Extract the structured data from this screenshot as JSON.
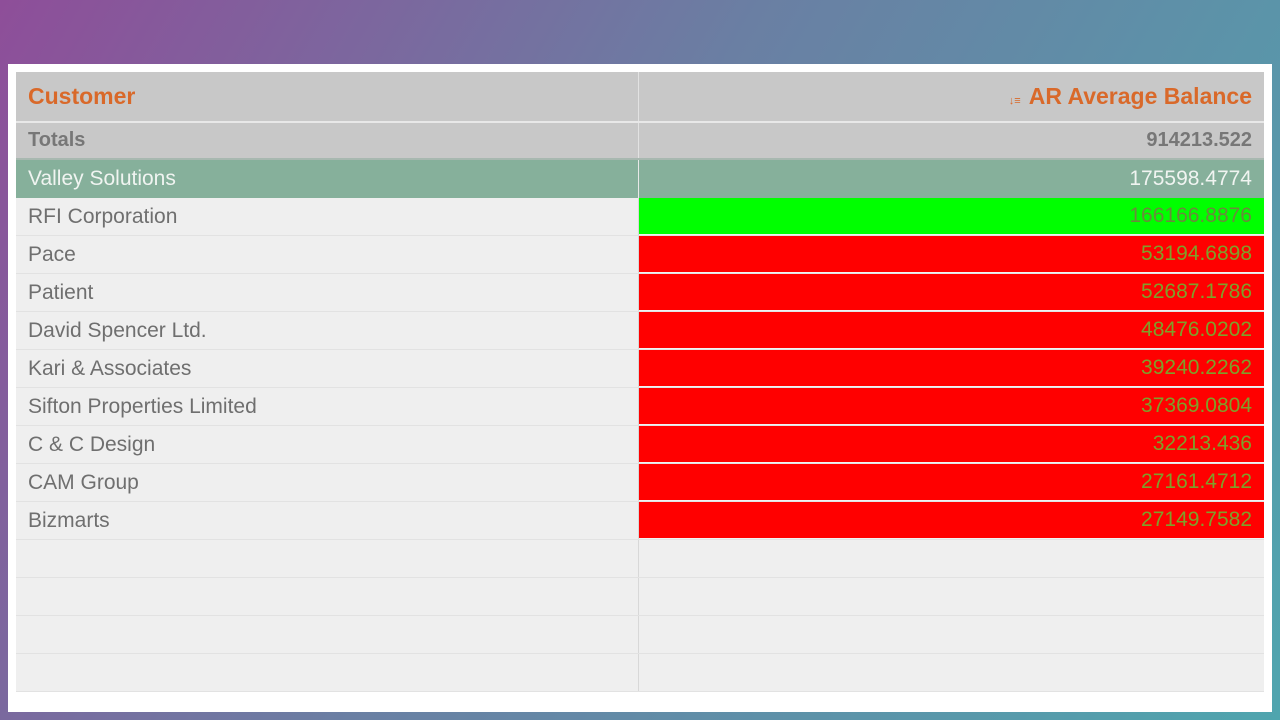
{
  "table": {
    "columns": [
      {
        "label": "Customer"
      },
      {
        "label": "AR Average Balance",
        "sort_icon": "sort-descending-icon"
      }
    ],
    "totals": {
      "label": "Totals",
      "value": "914213.522"
    },
    "selected": {
      "customer": "Valley Solutions",
      "value": "175598.4774"
    },
    "rows": [
      {
        "customer": "RFI Corporation",
        "value": "166166.8876",
        "status_color": "#00ff00"
      },
      {
        "customer": "Pace",
        "value": "53194.6898",
        "status_color": "#ff0000"
      },
      {
        "customer": "Patient",
        "value": "52687.1786",
        "status_color": "#ff0000"
      },
      {
        "customer": "David Spencer Ltd.",
        "value": "48476.0202",
        "status_color": "#ff0000"
      },
      {
        "customer": "Kari & Associates",
        "value": "39240.2262",
        "status_color": "#ff0000"
      },
      {
        "customer": "Sifton Properties Limited",
        "value": "37369.0804",
        "status_color": "#ff0000"
      },
      {
        "customer": "C & C Design",
        "value": "32213.436",
        "status_color": "#ff0000"
      },
      {
        "customer": "CAM Group",
        "value": "27161.4712",
        "status_color": "#ff0000"
      },
      {
        "customer": "Bizmarts",
        "value": "27149.7582",
        "status_color": "#ff0000"
      }
    ]
  },
  "colors": {
    "header_text": "#d9692a",
    "header_bg": "#c8c8c8",
    "selected_bg": "#86b09b",
    "positive": "#00ff00",
    "negative": "#ff0000"
  }
}
